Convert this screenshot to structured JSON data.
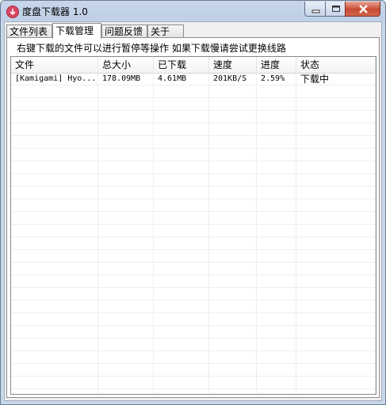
{
  "window": {
    "title": "度盘下载器 1.0"
  },
  "tabs": [
    {
      "label": "文件列表",
      "active": false
    },
    {
      "label": "下载管理",
      "active": true
    },
    {
      "label": "问题反馈",
      "active": false
    },
    {
      "label": "关于",
      "active": false
    }
  ],
  "hint": "右键下载的文件可以进行暂停等操作 如果下载慢请尝试更换线路",
  "list": {
    "columns": [
      "文件",
      "总大小",
      "已下载",
      "速度",
      "进度",
      "状态"
    ],
    "rows": [
      {
        "file": "[Kamigami] Hyo...",
        "size": "178.09MB",
        "downloaded": "4.61MB",
        "speed": "201KB/S",
        "progress": "2.59%",
        "status": "下载中"
      }
    ]
  }
}
